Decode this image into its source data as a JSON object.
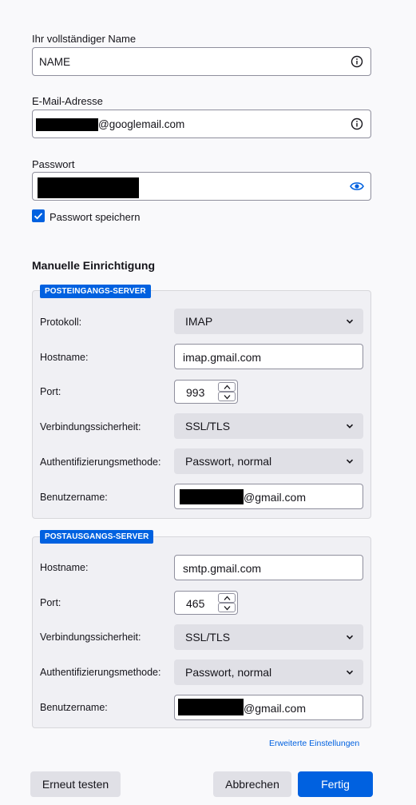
{
  "name_field": {
    "label": "Ihr vollständiger Name",
    "value": "NAME"
  },
  "email_field": {
    "label": "E-Mail-Adresse",
    "value_suffix": "@googlemail.com"
  },
  "password_field": {
    "label": "Passwort"
  },
  "remember_password": {
    "label": "Passwort speichern",
    "checked": true
  },
  "manual_setup_title": "Manuelle Einrichtigung",
  "incoming": {
    "badge": "POSTEINGANGS-SERVER",
    "protocol_label": "Protokoll:",
    "protocol_value": "IMAP",
    "hostname_label": "Hostname:",
    "hostname_value": "imap.gmail.com",
    "port_label": "Port:",
    "port_value": "993",
    "security_label": "Verbindungssicherheit:",
    "security_value": "SSL/TLS",
    "auth_label": "Authentifizierungsmethode:",
    "auth_value": "Passwort, normal",
    "username_label": "Benutzername:",
    "username_suffix": "@gmail.com"
  },
  "outgoing": {
    "badge": "POSTAUSGANGS-SERVER",
    "hostname_label": "Hostname:",
    "hostname_value": "smtp.gmail.com",
    "port_label": "Port:",
    "port_value": "465",
    "security_label": "Verbindungssicherheit:",
    "security_value": "SSL/TLS",
    "auth_label": "Authentifizierungsmethode:",
    "auth_value": "Passwort, normal",
    "username_label": "Benutzername:",
    "username_suffix": "@gmail.com"
  },
  "advanced_link": "Erweiterte Einstellungen",
  "buttons": {
    "retest": "Erneut testen",
    "cancel": "Abbrechen",
    "done": "Fertig"
  },
  "colors": {
    "accent": "#0061e0",
    "field_border": "#8f8f9d",
    "group_bg": "#f0f0f4"
  },
  "icons": {
    "info": "info-circle-icon",
    "reveal": "eye-icon",
    "dropdown": "chevron-down-icon"
  }
}
